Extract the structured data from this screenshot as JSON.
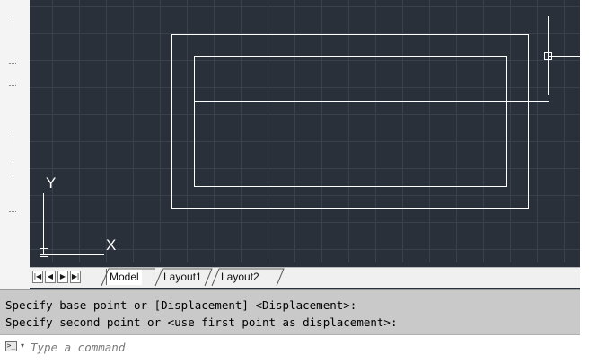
{
  "canvas": {
    "ucs_y_label": "Y",
    "ucs_x_label": "X",
    "background": "#2a303a",
    "line_color": "#ffffff"
  },
  "tabs": {
    "nav_first": "|◀",
    "nav_prev": "◀",
    "nav_next": "▶",
    "nav_last": "▶|",
    "items": [
      {
        "label": "Model",
        "active": true
      },
      {
        "label": "Layout1",
        "active": false
      },
      {
        "label": "Layout2",
        "active": false
      }
    ]
  },
  "command_history": [
    "Specify base point or [Displacement] <Displacement>:",
    "Specify second point or <use first point as displacement>:"
  ],
  "command_input": {
    "placeholder": "Type a command",
    "value": ""
  },
  "icons": {
    "prompt": "command-prompt-icon",
    "prompt_dropdown": "chevron-down-icon"
  }
}
